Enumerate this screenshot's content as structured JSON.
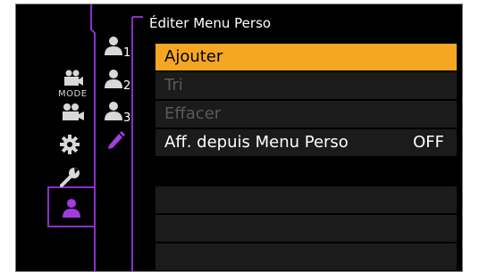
{
  "header": {
    "title": "Éditer Menu Perso"
  },
  "left_tabs": {
    "mode_label": "MODE",
    "icons": [
      "movie-mode-icon",
      "movie-camera-icon",
      "gear-icon",
      "wrench-icon",
      "my-menu-person-icon"
    ],
    "active_color": "#8b2fc9"
  },
  "sub_tabs": {
    "items": [
      {
        "icon": "my-menu-1-icon",
        "number": "1"
      },
      {
        "icon": "my-menu-2-icon",
        "number": "2"
      },
      {
        "icon": "my-menu-3-icon",
        "number": "3"
      },
      {
        "icon": "pencil-edit-icon",
        "number": ""
      }
    ]
  },
  "menu": {
    "items": [
      {
        "label": "Ajouter",
        "value": "",
        "state": "selected"
      },
      {
        "label": "Tri",
        "value": "",
        "state": "disabled"
      },
      {
        "label": "Effacer",
        "value": "",
        "state": "disabled"
      },
      {
        "label": "Aff. depuis Menu Perso",
        "value": "OFF",
        "state": "normal"
      },
      {
        "label": "",
        "value": "",
        "state": "empty"
      },
      {
        "label": "",
        "value": "",
        "state": "empty"
      },
      {
        "label": "",
        "value": "",
        "state": "empty"
      }
    ],
    "selected_color": "#f5a623"
  }
}
